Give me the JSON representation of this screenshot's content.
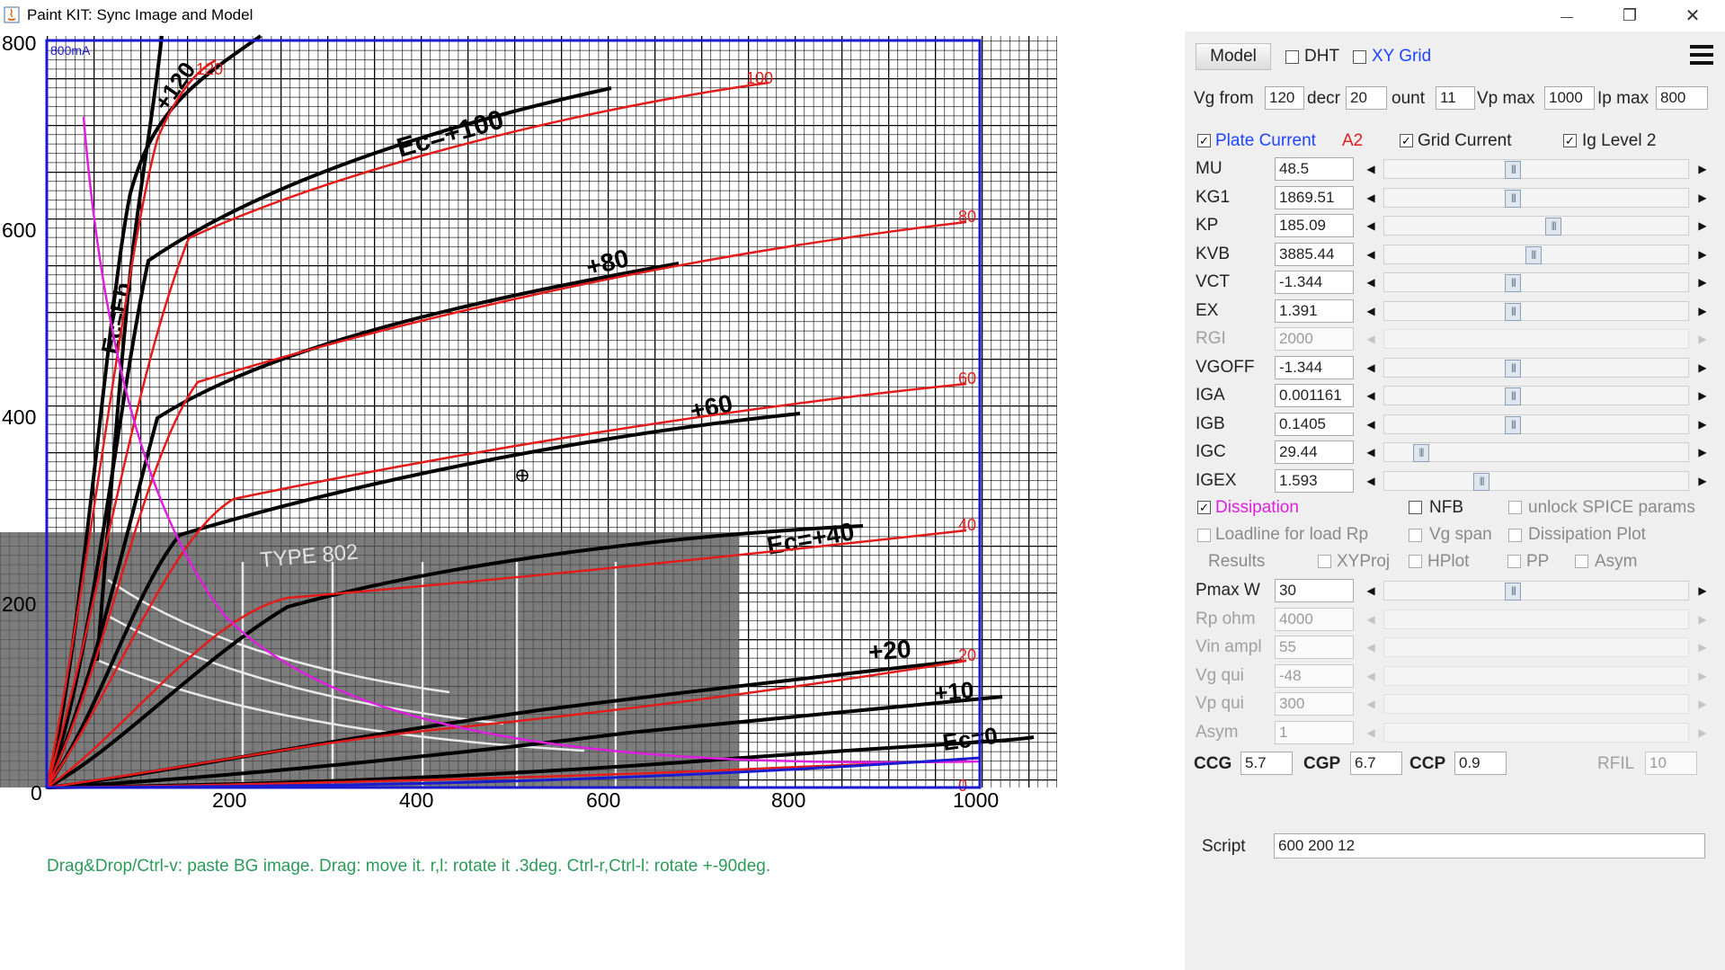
{
  "window": {
    "title": "Paint KIT: Sync Image and Model",
    "minimize_glyph": "—",
    "restore_glyph": "❐",
    "close_glyph": "✕"
  },
  "plot": {
    "hint": "Drag&Drop/Ctrl-v: paste BG image. Drag: move it. r,l: rotate it .3deg. Ctrl-r,Ctrl-l: rotate +-90deg.",
    "y_ticks": [
      "800",
      "600",
      "400",
      "200",
      "0"
    ],
    "x_ticks": [
      "200",
      "400",
      "600",
      "800",
      "1000"
    ],
    "corner_label": "800mA",
    "bg_labels": {
      "ec_100": "Ec=+100",
      "ec_80": "+80",
      "ec_60": "+60",
      "ec_40": "Ec=+40",
      "ec_20": "+20",
      "ec_10": "+10",
      "ec_0": "Ec=0",
      "ec_120": "+120",
      "ec_eb": "Ec=Eb",
      "type": "TYPE 802",
      "red_120": "120",
      "red_100": "100",
      "red_80": "80",
      "red_60": "60",
      "red_40": "40",
      "red_20": "20",
      "red_0": "0"
    },
    "colors": {
      "frame": "#1a1ad0",
      "model_curve": "#e31b1b",
      "dissipation": "#e01ee0",
      "hint": "#2e9a5a"
    }
  },
  "panel": {
    "model_button": "Model",
    "dht": {
      "label": "DHT",
      "checked": false
    },
    "xy_grid": {
      "label": "XY Grid",
      "checked": false
    },
    "menu_icon": "hamburger-menu-icon",
    "vg_from": {
      "label": "Vg from",
      "value": "120"
    },
    "decr": {
      "label": "decr",
      "value": "20"
    },
    "count": {
      "label": "ount",
      "value": "11"
    },
    "vp_max": {
      "label": "Vp max",
      "value": "1000"
    },
    "ip_max": {
      "label": "Ip max",
      "value": "800"
    },
    "plate_current": {
      "label": "Plate Current",
      "checked": true
    },
    "model_type": "A2",
    "grid_current": {
      "label": "Grid Current",
      "checked": true
    },
    "ig_level": {
      "label": "Ig Level 2",
      "checked": true
    },
    "params": [
      {
        "name": "MU",
        "value": "48.5",
        "position": 0.42,
        "disabled": false
      },
      {
        "name": "KG1",
        "value": "1869.51",
        "position": 0.42,
        "disabled": false
      },
      {
        "name": "KP",
        "value": "185.09",
        "position": 0.56,
        "disabled": false
      },
      {
        "name": "KVB",
        "value": "3885.44",
        "position": 0.49,
        "disabled": false
      },
      {
        "name": "VCT",
        "value": "-1.344",
        "position": 0.42,
        "disabled": false
      },
      {
        "name": "EX",
        "value": "1.391",
        "position": 0.42,
        "disabled": false
      },
      {
        "name": "RGI",
        "value": "2000",
        "position": null,
        "disabled": true
      },
      {
        "name": "VGOFF",
        "value": "-1.344",
        "position": 0.42,
        "disabled": false
      },
      {
        "name": "IGA",
        "value": "0.001161",
        "position": 0.42,
        "disabled": false
      },
      {
        "name": "IGB",
        "value": "0.1405",
        "position": 0.42,
        "disabled": false
      },
      {
        "name": "IGC",
        "value": "29.44",
        "position": 0.1,
        "disabled": false
      },
      {
        "name": "IGEX",
        "value": "1.593",
        "position": 0.31,
        "disabled": false
      }
    ],
    "dissipation": {
      "label": "Dissipation",
      "checked": true
    },
    "nfb": {
      "label": "NFB",
      "checked": false
    },
    "unlock_spice": {
      "label": "unlock SPICE params",
      "checked": false
    },
    "loadline": {
      "label": "Loadline for load Rp",
      "checked": false
    },
    "vg_span": {
      "label": "Vg span",
      "checked": false
    },
    "dissipation_plot": {
      "label": "Dissipation Plot",
      "checked": false
    },
    "results_label": "Results",
    "xyproj": {
      "label": "XYProj",
      "checked": false
    },
    "hplot": {
      "label": "HPlot",
      "checked": false
    },
    "pp": {
      "label": "PP",
      "checked": false
    },
    "asym_cb": {
      "label": "Asym",
      "checked": false
    },
    "load_params": [
      {
        "name": "Pmax W",
        "value": "30",
        "position": 0.42,
        "disabled": false
      },
      {
        "name": "Rp ohm",
        "value": "4000",
        "position": null,
        "disabled": true
      },
      {
        "name": "Vin ampl",
        "value": "55",
        "position": null,
        "disabled": true
      },
      {
        "name": "Vg qui",
        "value": "-48",
        "position": null,
        "disabled": true
      },
      {
        "name": "Vp qui",
        "value": "300",
        "position": null,
        "disabled": true
      },
      {
        "name": "Asym",
        "value": "1",
        "position": null,
        "disabled": true
      }
    ],
    "ccg": {
      "label": "CCG",
      "value": "5.7"
    },
    "cgp": {
      "label": "CGP",
      "value": "6.7"
    },
    "ccp": {
      "label": "CCP",
      "value": "0.9"
    },
    "rfil": {
      "label": "RFIL",
      "value": "10"
    },
    "script": {
      "label": "Script",
      "value": "600 200 12"
    }
  }
}
